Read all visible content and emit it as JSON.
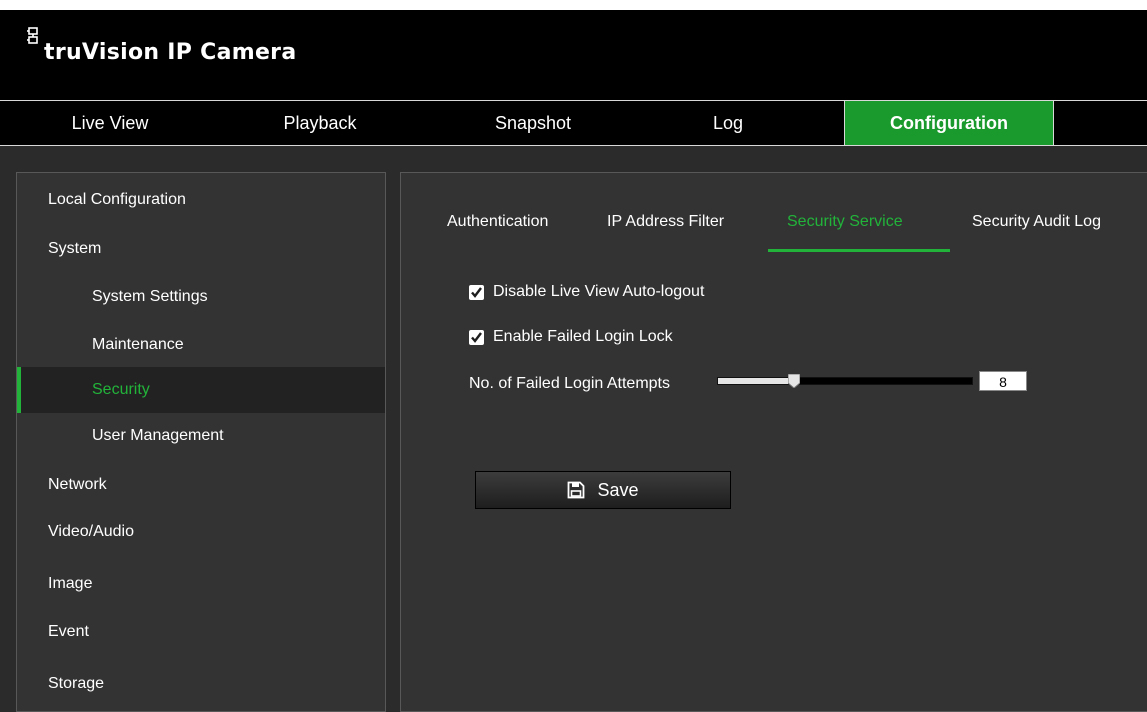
{
  "app": {
    "title": "truVision IP Camera",
    "logo_icon": "network-icon"
  },
  "nav": {
    "tabs": [
      {
        "label": "Live View"
      },
      {
        "label": "Playback"
      },
      {
        "label": "Snapshot"
      },
      {
        "label": "Log"
      },
      {
        "label": "Configuration",
        "active": true
      }
    ]
  },
  "sidebar": {
    "items": [
      {
        "label": "Local Configuration",
        "level": "top"
      },
      {
        "label": "System",
        "level": "top"
      },
      {
        "label": "System Settings",
        "level": "sub"
      },
      {
        "label": "Maintenance",
        "level": "sub"
      },
      {
        "label": "Security",
        "level": "sub",
        "active": true
      },
      {
        "label": "User Management",
        "level": "sub"
      },
      {
        "label": "Network",
        "level": "top"
      },
      {
        "label": "Video/Audio",
        "level": "top"
      },
      {
        "label": "Image",
        "level": "top"
      },
      {
        "label": "Event",
        "level": "top"
      },
      {
        "label": "Storage",
        "level": "top"
      }
    ]
  },
  "content": {
    "tabs": [
      {
        "label": "Authentication"
      },
      {
        "label": "IP Address Filter"
      },
      {
        "label": "Security Service",
        "active": true
      },
      {
        "label": "Security Audit Log"
      }
    ],
    "options": [
      {
        "label": "Disable Live View Auto-logout",
        "checked": true
      },
      {
        "label": "Enable Failed Login Lock",
        "checked": true
      }
    ],
    "attempts": {
      "label": "No. of Failed Login Attempts",
      "value": "8",
      "slider_fraction": 0.3
    },
    "save_label": "Save",
    "save_icon": "floppy-disk-icon"
  },
  "colors": {
    "accent": "#1a9a2c",
    "active_text": "#22b33a",
    "panel": "#333333",
    "background": "#2b2b2b"
  }
}
